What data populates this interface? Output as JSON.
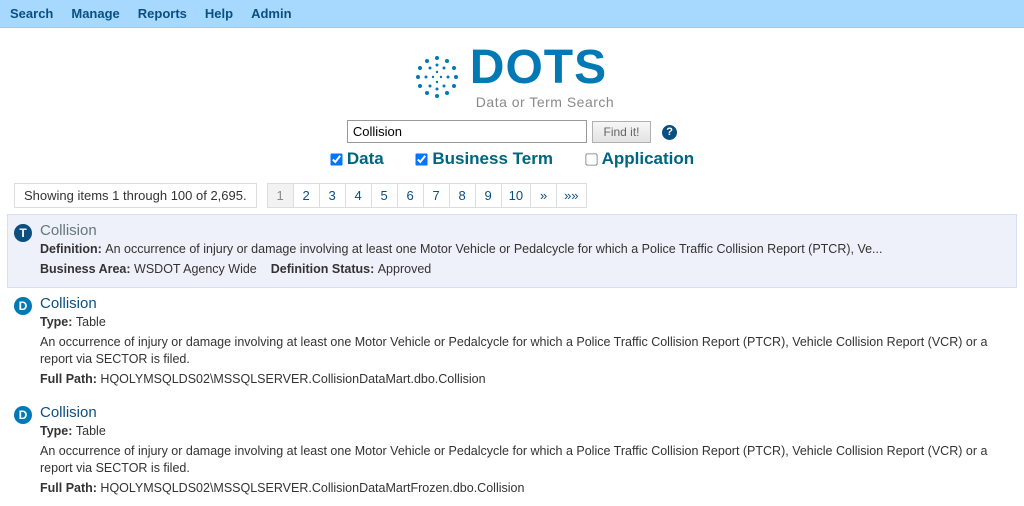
{
  "nav": {
    "items": [
      "Search",
      "Manage",
      "Reports",
      "Help",
      "Admin"
    ]
  },
  "logo": {
    "main": "DOTS",
    "sub": "Data or Term Search"
  },
  "search": {
    "value": "Collision",
    "button": "Find it!",
    "help": "?"
  },
  "filters": {
    "data": {
      "label": "Data",
      "checked": true
    },
    "term": {
      "label": "Business Term",
      "checked": true
    },
    "app": {
      "label": "Application",
      "checked": false
    }
  },
  "pager": {
    "status": "Showing items 1 through 100 of 2,695.",
    "pages": [
      "1",
      "2",
      "3",
      "4",
      "5",
      "6",
      "7",
      "8",
      "9",
      "10",
      "»",
      "»»"
    ],
    "current": "1"
  },
  "results": [
    {
      "badge": "T",
      "title": "Collision",
      "highlighted": true,
      "lines": [
        {
          "label": "Definition:",
          "text": "An occurrence of injury or damage involving at least one Motor Vehicle or Pedalcycle for which a Police Traffic Collision Report (PTCR), Ve..."
        },
        {
          "pairs": [
            {
              "label": "Business Area:",
              "text": "WSDOT Agency Wide"
            },
            {
              "label": "Definition Status:",
              "text": "Approved"
            }
          ]
        }
      ]
    },
    {
      "badge": "D",
      "title": "Collision",
      "highlighted": false,
      "lines": [
        {
          "label": "Type:",
          "text": "Table"
        },
        {
          "text": "An occurrence of injury or damage involving at least one Motor Vehicle or Pedalcycle for which a Police Traffic Collision Report (PTCR), Vehicle Collision Report (VCR) or a report via SECTOR is filed."
        },
        {
          "label": "Full Path:",
          "text": "HQOLYMSQLDS02\\MSSQLSERVER.CollisionDataMart.dbo.Collision"
        }
      ]
    },
    {
      "badge": "D",
      "title": "Collision",
      "highlighted": false,
      "lines": [
        {
          "label": "Type:",
          "text": "Table"
        },
        {
          "text": "An occurrence of injury or damage involving at least one Motor Vehicle or Pedalcycle for which a Police Traffic Collision Report (PTCR), Vehicle Collision Report (VCR) or a report via SECTOR is filed."
        },
        {
          "label": "Full Path:",
          "text": "HQOLYMSQLDS02\\MSSQLSERVER.CollisionDataMartFrozen.dbo.Collision"
        }
      ]
    }
  ]
}
